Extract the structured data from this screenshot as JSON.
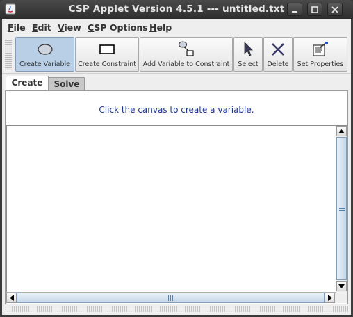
{
  "window": {
    "title": "CSP Applet Version 4.5.1 --- untitled.txt"
  },
  "menu": {
    "items": [
      {
        "label": "File",
        "mnemonic": "F",
        "rest": "ile"
      },
      {
        "label": "Edit",
        "mnemonic": "E",
        "rest": "dit"
      },
      {
        "label": "View",
        "mnemonic": "V",
        "rest": "iew"
      },
      {
        "label": "CSP Options",
        "mnemonic": "C",
        "rest": "SP Options"
      },
      {
        "label": "Help",
        "mnemonic": "H",
        "rest": "elp"
      }
    ]
  },
  "toolbar": {
    "buttons": [
      {
        "label": "Create Variable",
        "icon": "ellipse-icon",
        "selected": true
      },
      {
        "label": "Create Constraint",
        "icon": "rectangle-icon",
        "selected": false
      },
      {
        "label": "Add Variable to Constraint",
        "icon": "link-icon",
        "selected": false
      },
      {
        "label": "Select",
        "icon": "pointer-icon",
        "selected": false
      },
      {
        "label": "Delete",
        "icon": "x-icon",
        "selected": false
      },
      {
        "label": "Set Properties",
        "icon": "properties-icon",
        "selected": false
      }
    ]
  },
  "tabs": [
    {
      "label": "Create",
      "active": true
    },
    {
      "label": "Solve",
      "active": false
    }
  ],
  "panel": {
    "message": "Click the canvas to create a variable."
  },
  "colors": {
    "selected_button": "#b8cfe5",
    "message_text": "#1a3399",
    "titlebar": "#2e2e2e"
  }
}
